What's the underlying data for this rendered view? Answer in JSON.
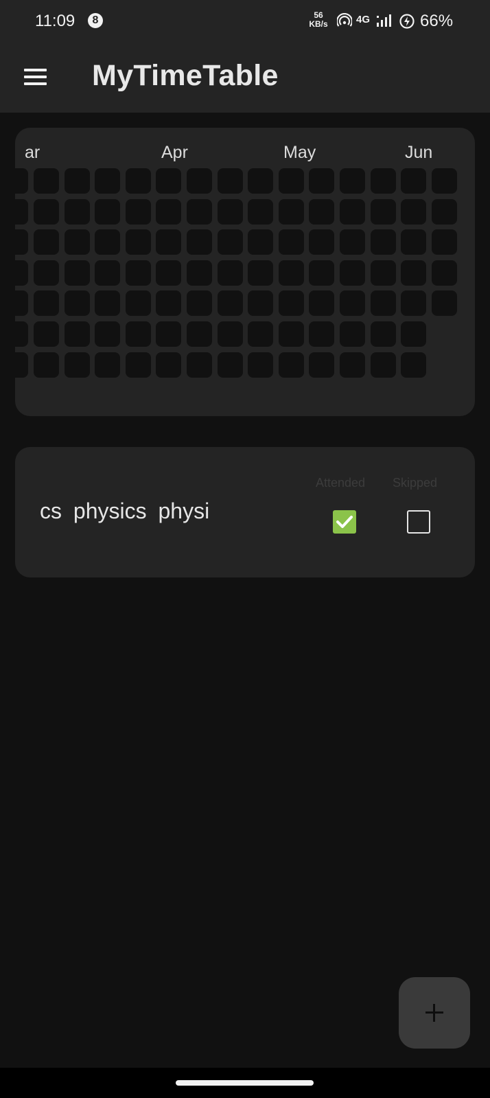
{
  "status_bar": {
    "time": "11:09",
    "badge": "8",
    "speed_value": "56",
    "speed_unit": "KB/s",
    "network": "4G",
    "battery_percent": "66%",
    "icons": [
      "hotspot-icon",
      "signal-icon",
      "battery-charging-icon"
    ]
  },
  "app_bar": {
    "title": "MyTimeTable",
    "menu_icon": "hamburger-menu-icon"
  },
  "heatmap": {
    "months": [
      "ar",
      "Apr",
      "May",
      "Jun"
    ],
    "cell_color": "#111111",
    "card_color": "#242424"
  },
  "class_row": {
    "name": "cs  physics  physi",
    "attended_label": "Attended",
    "skipped_label": "Skipped",
    "attended_checked": true,
    "skipped_checked": false,
    "attended_color": "#8bc34a"
  },
  "fab": {
    "icon": "plus-icon"
  },
  "colors": {
    "background": "#111111",
    "surface": "#242424",
    "fab": "#3a3a3a"
  }
}
